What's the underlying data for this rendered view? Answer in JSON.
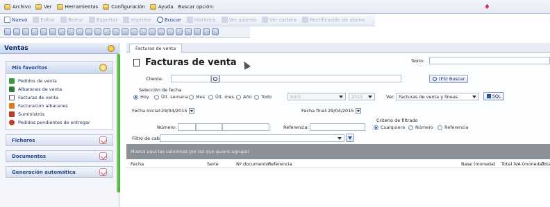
{
  "menubar": {
    "items": [
      "Archivo",
      "Ver",
      "Herramientas",
      "Configuración",
      "Ayuda"
    ],
    "search_label": "Buscar opción:"
  },
  "toolbar": {
    "buttons": [
      {
        "label": "Nuevo",
        "enabled": true,
        "icon": "new-document-icon"
      },
      {
        "label": "Editar",
        "enabled": false,
        "icon": "edit-icon"
      },
      {
        "label": "Borrar",
        "enabled": false,
        "icon": "delete-icon"
      },
      {
        "label": "Exportar",
        "enabled": false,
        "icon": "export-icon"
      },
      {
        "label": "Imprimir",
        "enabled": false,
        "icon": "print-icon"
      },
      {
        "label": "Buscar",
        "enabled": true,
        "icon": "search-icon"
      },
      {
        "label": "Histórico",
        "enabled": false,
        "icon": "history-icon"
      },
      {
        "label": "Ver asiento",
        "enabled": false,
        "icon": "view-entry-icon"
      },
      {
        "label": "Ver cartera",
        "enabled": false,
        "icon": "view-portfolio-icon"
      },
      {
        "label": "Rectificación de abono",
        "enabled": false,
        "icon": "rectification-icon"
      }
    ]
  },
  "sidebar": {
    "title": "Ventas",
    "favorites": {
      "title": "Mis favoritos",
      "items": [
        {
          "label": "Pedidos de venta",
          "icon": "sales-order-icon",
          "color": "#3b9a3f"
        },
        {
          "label": "Albaranes de venta",
          "icon": "delivery-note-icon",
          "color": "#2f7d3a"
        },
        {
          "label": "Facturas de venta",
          "icon": "invoice-icon",
          "color": "#555555"
        },
        {
          "label": "Facturación albaranes",
          "icon": "billing-icon",
          "color": "#e27a1a"
        },
        {
          "label": "Suministros",
          "icon": "supplies-icon",
          "color": "#c0392b"
        },
        {
          "label": "Pedidos pendientes de entregar",
          "icon": "pending-orders-icon",
          "color": "#c0392b"
        }
      ]
    },
    "sections": [
      "Ficheros",
      "Documentos",
      "Generación automática"
    ]
  },
  "tabs": [
    "Facturas de venta"
  ],
  "form": {
    "title": "Facturas de venta",
    "texto_label": "Texto:",
    "cliente_label": "Cliente:",
    "search_button": "(F5) Buscar",
    "fecha_group_label": "Selección de fecha",
    "date_options": [
      "Hoy",
      "Últ. semana",
      "Mes",
      "Últ. mes",
      "Año",
      "Todo"
    ],
    "selected_date_option": "Hoy",
    "month_value": "Abril",
    "year_value": "2015",
    "ver_label": "Ver:",
    "ver_value": "Facturas de venta y líneas",
    "sql_button": "SQL",
    "fecha_inicial_label": "Fecha inicial:",
    "fecha_inicial_value": "29/04/2015",
    "fecha_final_label": "Fecha final:",
    "fecha_final_value": "29/04/2015",
    "numero_label": "Número:",
    "referencia_label": "Referencia:",
    "criterio_label": "Criterio de filtrado",
    "criterio_options": [
      "Cualquiera",
      "Número",
      "Referencia"
    ],
    "selected_criterio": "Cualquiera",
    "filtro_label": "Filtro de cabecera:"
  },
  "grid": {
    "group_hint": "Mueva aquí las columnas por las que quiere agrupar",
    "columns": [
      "Fecha",
      "Serie",
      "Nº documento",
      "Referencia",
      "Base (moneda)",
      "Total IVA (moneda)",
      "Total"
    ]
  }
}
